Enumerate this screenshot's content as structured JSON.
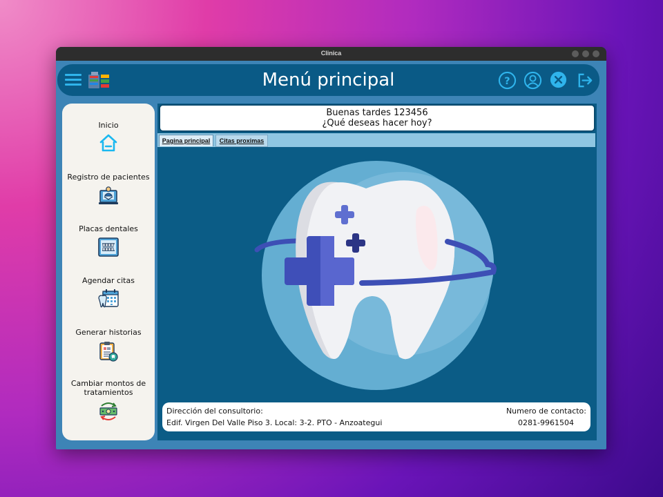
{
  "window": {
    "title": "Clinica"
  },
  "header": {
    "title": "Menú principal",
    "icons": [
      "menu-icon",
      "app-logo",
      "help-icon",
      "user-profile-icon",
      "close-icon",
      "logout-icon"
    ],
    "accent_color": "#2fb4ec"
  },
  "sidebar": {
    "items": [
      {
        "label": "Inicio",
        "icon": "home-icon"
      },
      {
        "label": "Registro de pacientes",
        "icon": "patient-register-icon"
      },
      {
        "label": "Placas dentales",
        "icon": "dental-xray-icon"
      },
      {
        "label": "Agendar citas",
        "icon": "calendar-tooth-icon"
      },
      {
        "label": "Generar historias",
        "icon": "clipboard-history-icon"
      },
      {
        "label": "Cambiar montos de tratamientos",
        "icon": "money-exchange-icon"
      }
    ]
  },
  "greeting": {
    "line1": "Buenas tardes 123456",
    "line2": "¿Qué deseas hacer hoy?"
  },
  "tabs": [
    {
      "label": "Pagina principal",
      "active": true
    },
    {
      "label": "Citas proximas",
      "active": false
    }
  ],
  "footer": {
    "address_label": "Dirección del consultorio:",
    "address": "Edif. Virgen Del Valle Piso 3. Local: 3-2. PTO - Anzoategui",
    "contact_label": "Numero de contacto:",
    "phone": "0281-9961504"
  }
}
